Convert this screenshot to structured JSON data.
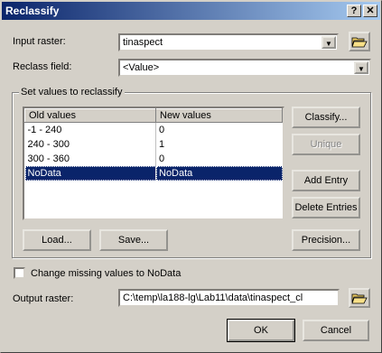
{
  "window": {
    "title": "Reclassify"
  },
  "titlebar_buttons": {
    "help": "?",
    "close": "✕"
  },
  "input_raster": {
    "label": "Input raster:",
    "value": "tinaspect"
  },
  "reclass_field": {
    "label": "Reclass field:",
    "value": "<Value>"
  },
  "group": {
    "title": "Set values to reclassify"
  },
  "table": {
    "columns": [
      "Old values",
      "New values"
    ],
    "rows": [
      {
        "old": "-1 - 240",
        "new": "0"
      },
      {
        "old": "240 - 300",
        "new": "1"
      },
      {
        "old": "300 - 360",
        "new": "0"
      },
      {
        "old": "NoData",
        "new": "NoData",
        "selected": true
      }
    ]
  },
  "buttons": {
    "classify": "Classify...",
    "unique": "Unique",
    "add_entry": "Add Entry",
    "delete_entries": "Delete Entries",
    "load": "Load...",
    "save": "Save...",
    "precision": "Precision...",
    "ok": "OK",
    "cancel": "Cancel"
  },
  "change_missing": {
    "label": "Change missing values to NoData",
    "checked": false
  },
  "output_raster": {
    "label": "Output raster:",
    "value": "C:\\temp\\la188-lg\\Lab11\\data\\tinaspect_cl"
  },
  "icons": [
    "folder-open-icon",
    "dropdown-arrow-icon",
    "help-icon",
    "close-icon"
  ]
}
